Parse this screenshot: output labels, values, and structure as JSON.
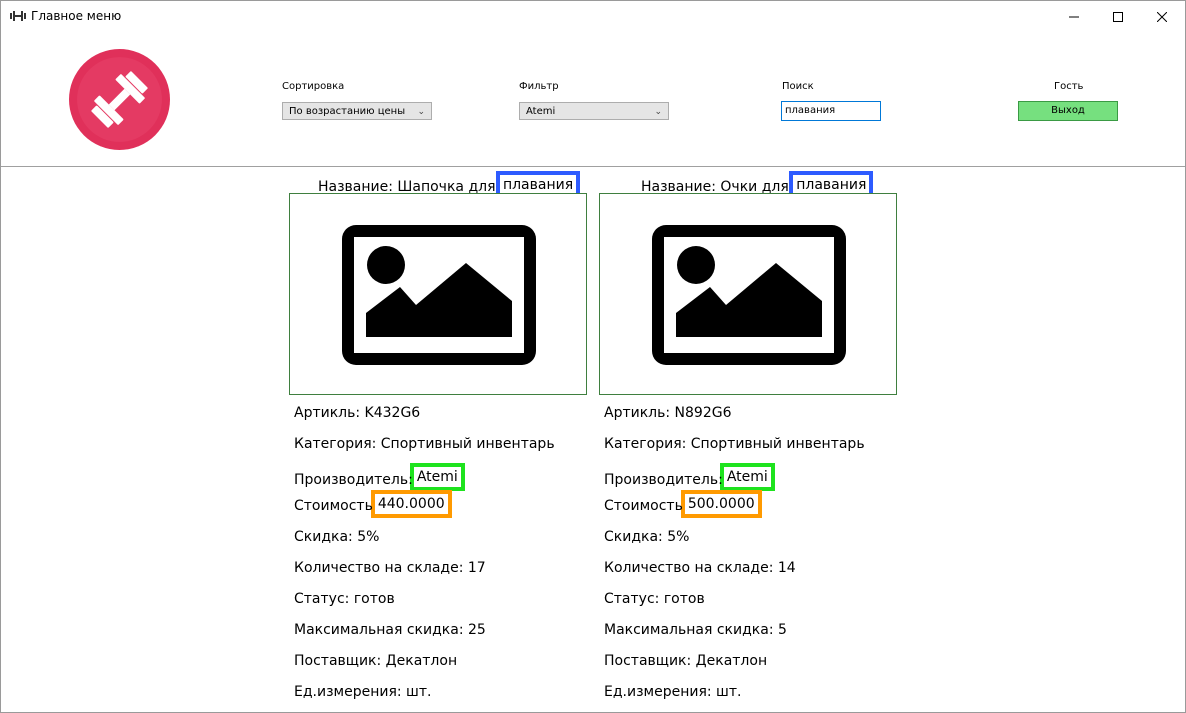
{
  "window": {
    "title": "Главное меню",
    "app_icon": "dumbbell-icon"
  },
  "header": {
    "logo_icon": "dumbbell-logo-icon",
    "logo_color": "#e0305a",
    "sort": {
      "label": "Сортировка",
      "value": "По возрастанию цены"
    },
    "filter": {
      "label": "Фильтр",
      "value": "Atemi"
    },
    "search": {
      "label": "Поиск",
      "value": "плавания"
    },
    "user": {
      "label": "Гость"
    },
    "exit_label": "Выход",
    "exit_color": "#76e07f"
  },
  "highlight_colors": {
    "search_match": "#2d5bff",
    "filter_match": "#1ee31e",
    "price": "#ff9a00"
  },
  "products": [
    {
      "title_prefix": "Название: Шапочка для ",
      "title_match": "плавания",
      "image_icon": "image-placeholder-icon",
      "article": "Артикль: K432G6",
      "category": "Категория: Спортивный инвентарь",
      "manufacturer_label": "Производитель:",
      "manufacturer": "Atemi",
      "price_label": "Стоимость",
      "price": "440.0000",
      "discount": "Скидка: 5%",
      "stock": "Количество на складе: 17",
      "status": "Статус: готов",
      "max_discount": "Максимальная скидка: 25",
      "supplier": "Поставщик: Декатлон",
      "unit": "Ед.измерения: шт."
    },
    {
      "title_prefix": "Название: Очки для ",
      "title_match": "плавания",
      "image_icon": "image-placeholder-icon",
      "article": "Артикль: N892G6",
      "category": "Категория: Спортивный инвентарь",
      "manufacturer_label": "Производитель:",
      "manufacturer": "Atemi",
      "price_label": "Стоимость",
      "price": "500.0000",
      "discount": "Скидка: 5%",
      "stock": "Количество на складе: 14",
      "status": "Статус: готов",
      "max_discount": "Максимальная скидка: 5",
      "supplier": "Поставщик: Декатлон",
      "unit": "Ед.измерения: шт."
    }
  ]
}
